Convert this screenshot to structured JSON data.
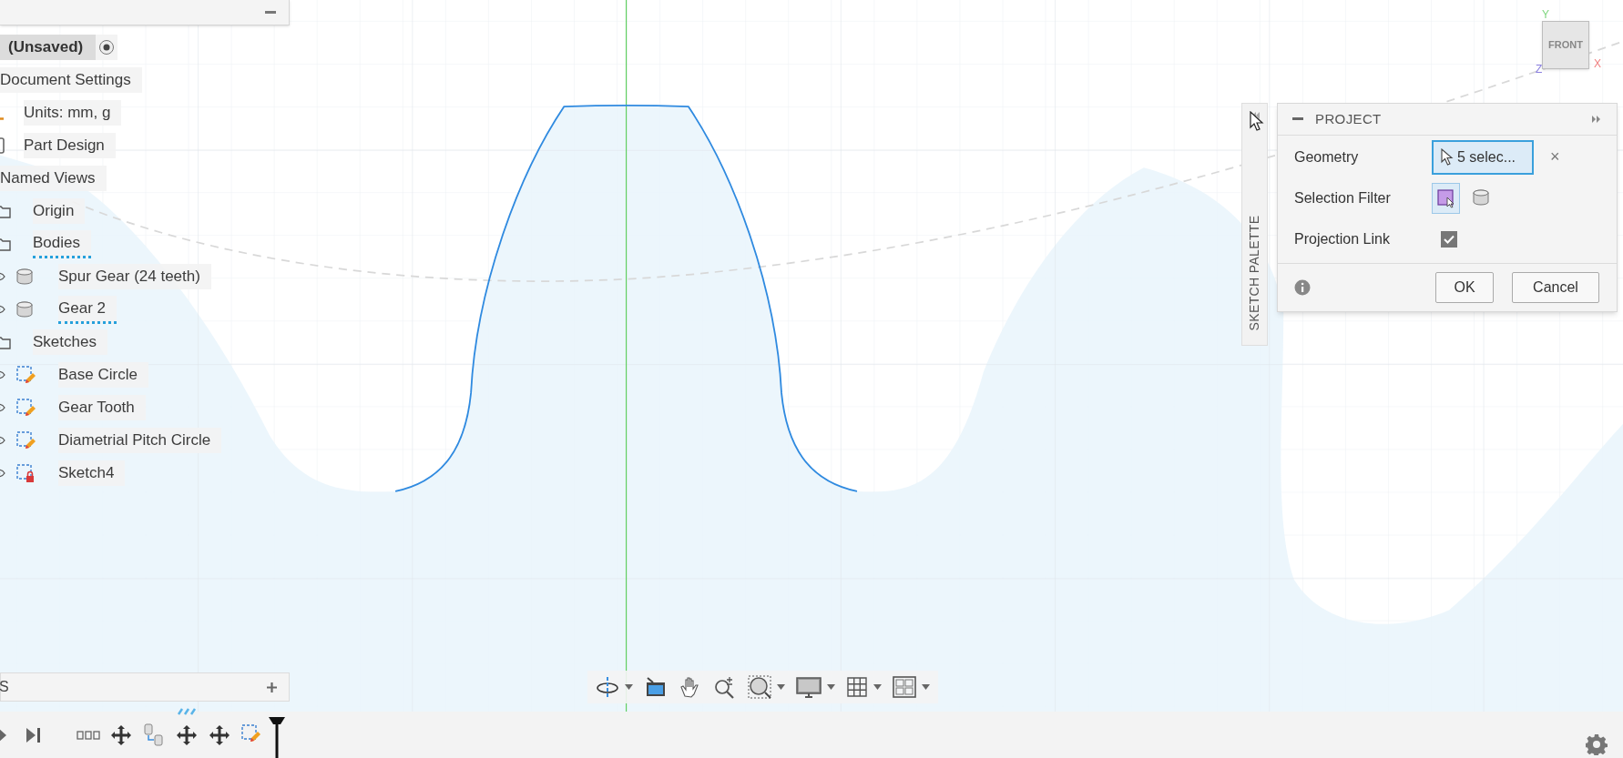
{
  "browser": {
    "items": [
      {
        "label": "(Unsaved)",
        "kind": "document",
        "marked": false,
        "children": [
          {
            "label": "Document Settings",
            "kind": "group",
            "marked": false,
            "children": [
              {
                "label": "Units: mm, g",
                "kind": "units",
                "marked": false
              },
              {
                "label": "Part Design",
                "kind": "design",
                "marked": false
              }
            ]
          },
          {
            "label": "Named Views",
            "kind": "group",
            "marked": false
          },
          {
            "label": "Origin",
            "kind": "folder",
            "marked": false
          },
          {
            "label": "Bodies",
            "kind": "folder",
            "marked": true,
            "children": [
              {
                "label": "Spur Gear (24 teeth)",
                "kind": "body",
                "marked": false
              },
              {
                "label": "Gear 2",
                "kind": "body",
                "marked": true
              }
            ]
          },
          {
            "label": "Sketches",
            "kind": "folder",
            "marked": false,
            "children": [
              {
                "label": "Base Circle",
                "kind": "sketch",
                "locked": false,
                "marked": false
              },
              {
                "label": "Gear Tooth",
                "kind": "sketch",
                "locked": false,
                "marked": false
              },
              {
                "label": "Diametrial Pitch Circle",
                "kind": "sketch",
                "locked": false,
                "marked": false
              },
              {
                "label": "Sketch4",
                "kind": "sketch",
                "locked": true,
                "marked": false
              }
            ]
          }
        ]
      }
    ]
  },
  "comments_panel": {
    "title": "S"
  },
  "view_cube": {
    "face": "FRONT",
    "axes": [
      {
        "label": "Y",
        "color": "#7ed67e"
      },
      {
        "label": "X",
        "color": "#f08080"
      },
      {
        "label": "Z",
        "color": "#8a7fe0"
      }
    ]
  },
  "sketch_palette": {
    "label": "SKETCH PALETTE"
  },
  "project_panel": {
    "title": "PROJECT",
    "rows": [
      {
        "label": "Geometry",
        "kind": "selection",
        "value": "5 selec...",
        "selected": true,
        "clear": "×"
      },
      {
        "label": "Selection Filter",
        "kind": "filter",
        "filters": [
          {
            "kind": "sketch",
            "selected": true
          },
          {
            "kind": "body",
            "selected": false
          }
        ]
      },
      {
        "label": "Projection Link",
        "kind": "checkbox",
        "checked": true
      }
    ],
    "buttons": [
      "OK",
      "Cancel"
    ]
  },
  "nav_toolbar": [
    {
      "kind": "orbit",
      "dropdown": true
    },
    {
      "kind": "look",
      "dropdown": false
    },
    {
      "kind": "pan",
      "dropdown": false
    },
    {
      "kind": "zoom",
      "dropdown": false
    },
    {
      "kind": "fit",
      "dropdown": true
    },
    {
      "kind": "display",
      "dropdown": true
    },
    {
      "kind": "grid",
      "dropdown": true
    },
    {
      "kind": "viewports",
      "dropdown": true
    }
  ],
  "timeline": {
    "items": [
      {
        "kind": "features",
        "marked": false
      },
      {
        "kind": "move",
        "marked": false
      },
      {
        "kind": "derive",
        "marked": false
      },
      {
        "kind": "move",
        "marked": true
      },
      {
        "kind": "move",
        "marked": false
      },
      {
        "kind": "sketch",
        "marked": false
      }
    ]
  }
}
